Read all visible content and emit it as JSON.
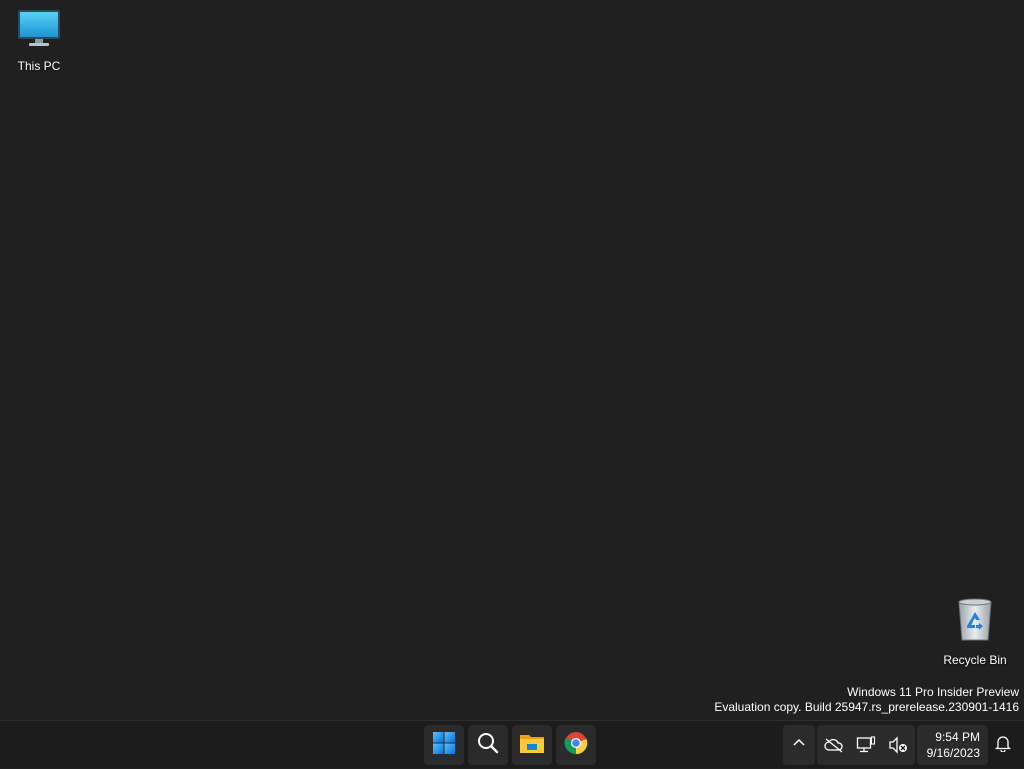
{
  "desktop": {
    "icons": [
      {
        "label": "This PC",
        "icon": "monitor-icon"
      },
      {
        "label": "Recycle Bin",
        "icon": "recycle-bin-icon"
      }
    ],
    "watermark": {
      "line1": "Windows 11 Pro Insider Preview",
      "line2": "Evaluation copy. Build 25947.rs_prerelease.230901-1416"
    },
    "background_color": "#202020"
  },
  "taskbar": {
    "apps": [
      {
        "name": "Start",
        "icon": "windows-start-icon"
      },
      {
        "name": "Search",
        "icon": "search-icon"
      },
      {
        "name": "File Explorer",
        "icon": "folder-icon"
      },
      {
        "name": "Google Chrome",
        "icon": "chrome-icon"
      }
    ],
    "tray": {
      "icons": [
        "chevron-up-icon",
        "onedrive-offline-icon",
        "network-icon",
        "volume-muted-icon"
      ]
    },
    "clock": {
      "time": "9:54 PM",
      "date": "9/16/2023"
    },
    "accent_color": "#0078d4"
  }
}
